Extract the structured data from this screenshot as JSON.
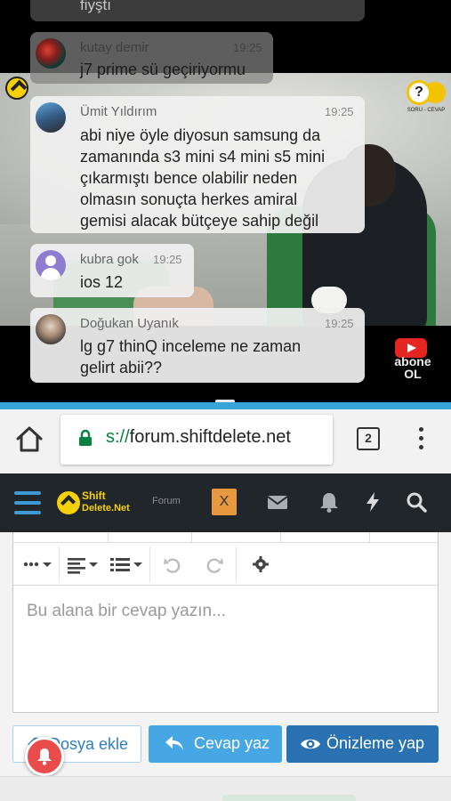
{
  "chat": {
    "top_partial": {
      "msg": "fiyştı"
    },
    "messages": [
      {
        "name": "kutay demir",
        "time": "19:25",
        "msg": [
          "j7 prime sü geçiriyormu"
        ]
      },
      {
        "name": "Ümit Yıldırım",
        "time": "19:25",
        "msg": [
          "abi niye öyle diyosun samsung da",
          "zamanında s3 mini s4 mini s5 mini",
          "çıkarmıştı bence olabilir neden",
          "olmasın sonuçta herkes amiral",
          "gemisi alacak bütçeye sahip değil"
        ]
      },
      {
        "name": "kubra gok",
        "time": "19:25",
        "msg": [
          "ios 12"
        ]
      },
      {
        "name": "Doğukan Uyanık",
        "time": "19:25",
        "msg": [
          "lg g7 thinQ inceleme ne zaman",
          "gelirt abii??"
        ]
      }
    ]
  },
  "video_overlay": {
    "soru_label": "SORU - CEVAP",
    "soru_symbol": "?",
    "abone_line1": "abone",
    "abone_line2": "OL"
  },
  "browser": {
    "url_scheme": "s://",
    "url_host": "forum.shiftdelete.net",
    "tab_count": "2"
  },
  "site_nav": {
    "logo_line1": "Shift",
    "logo_line2": "Delete.Net",
    "forum_label": "Forum",
    "x_label": "X"
  },
  "editor": {
    "placeholder": "Bu alana bir cevap yazın..."
  },
  "actions": {
    "attach_label": "Dosya ekle",
    "reply_label": "Cevap yaz",
    "preview_label": "Önizleme yap"
  },
  "colors": {
    "accent_blue": "#38a3d8",
    "reply_blue": "#47a7e4",
    "preview_blue": "#2a71b2",
    "nav_dark": "#21262b",
    "brand_yellow": "#f5d10a",
    "notif_red": "#ea4b4b"
  }
}
